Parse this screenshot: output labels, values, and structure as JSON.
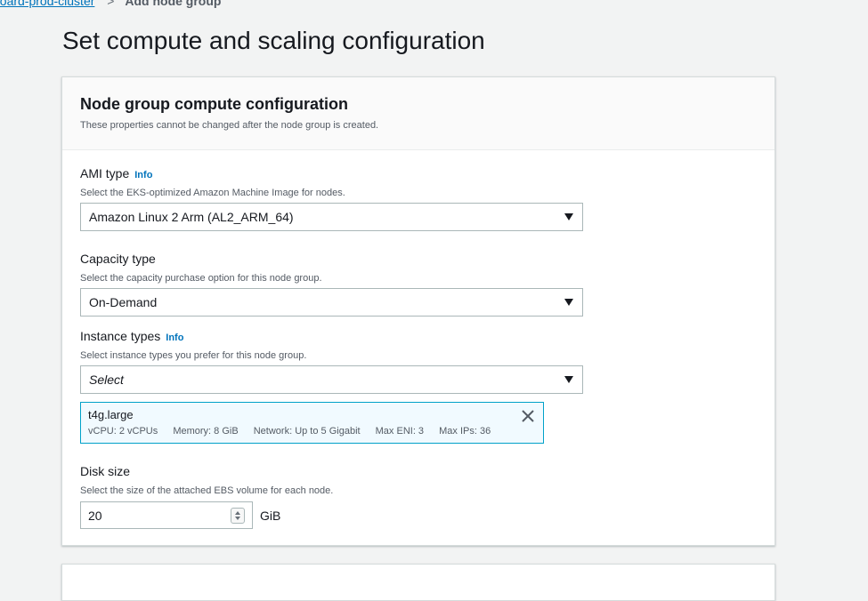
{
  "breadcrumb": {
    "cluster_link": "board-prod-cluster",
    "separator": ">",
    "current": "Add node group"
  },
  "page_title": "Set compute and scaling configuration",
  "panel": {
    "title": "Node group compute configuration",
    "description": "These properties cannot be changed after the node group is created."
  },
  "ami_type": {
    "label": "AMI type",
    "info": "Info",
    "description": "Select the EKS-optimized Amazon Machine Image for nodes.",
    "value": "Amazon Linux 2 Arm (AL2_ARM_64)"
  },
  "capacity_type": {
    "label": "Capacity type",
    "description": "Select the capacity purchase option for this node group.",
    "value": "On-Demand"
  },
  "instance_types": {
    "label": "Instance types",
    "info": "Info",
    "description": "Select instance types you prefer for this node group.",
    "placeholder": "Select",
    "selected": {
      "name": "t4g.large",
      "vcpu": "vCPU: 2 vCPUs",
      "memory": "Memory: 8 GiB",
      "network": "Network: Up to 5 Gigabit",
      "max_eni": "Max ENI: 3",
      "max_ips": "Max IPs: 36"
    }
  },
  "disk_size": {
    "label": "Disk size",
    "description": "Select the size of the attached EBS volume for each node.",
    "value": "20",
    "unit": "GiB"
  },
  "icons": {
    "dropdown": "caret-down-icon",
    "remove": "close-icon",
    "spinner": "spinner-icon"
  },
  "colors": {
    "link": "#0073bb",
    "token_border": "#00a1c9",
    "token_bg": "#f1faff",
    "background": "#f2f3f3"
  }
}
